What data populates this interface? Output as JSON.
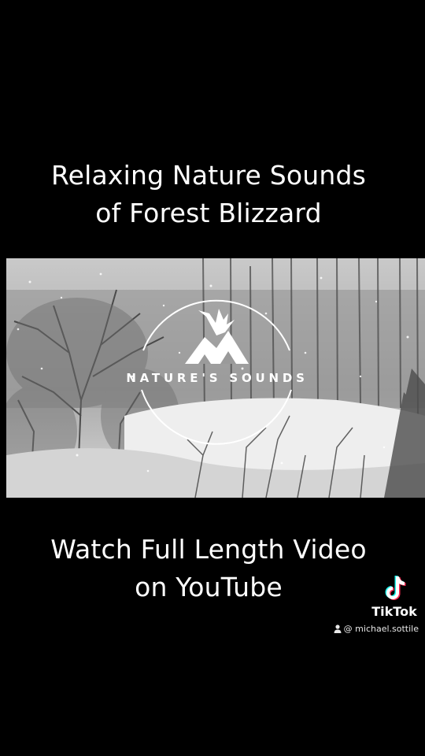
{
  "caption_top": {
    "line1": "Relaxing Nature Sounds",
    "line2": "of Forest Blizzard"
  },
  "video": {
    "logo_text": "NATURE'S SOUNDS"
  },
  "caption_bottom": {
    "line1": "Watch Full Length Video",
    "line2": "on YouTube"
  },
  "watermark": {
    "brand": "TikTok",
    "handle": "@ michael.sottile",
    "icon": "tiktok-note-icon",
    "user_icon": "person-icon"
  },
  "colors": {
    "background": "#000000",
    "text": "#ffffff",
    "tiktok_cyan": "#25f4ee",
    "tiktok_red": "#fe2c55"
  }
}
